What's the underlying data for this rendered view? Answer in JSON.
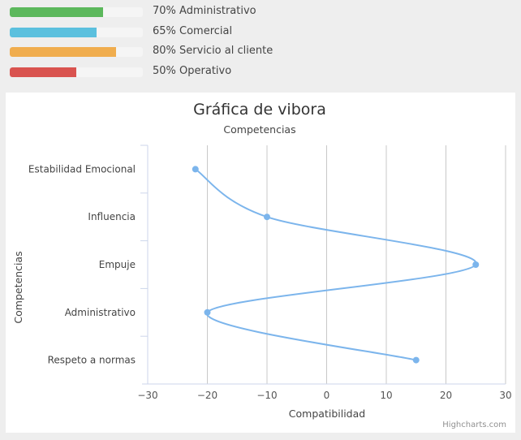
{
  "progress_bars": [
    {
      "label": "70% Administrativo",
      "value": 70,
      "color": "#5cb85c"
    },
    {
      "label": "65% Comercial",
      "value": 65,
      "color": "#5bc0de"
    },
    {
      "label": "80% Servicio al cliente",
      "value": 80,
      "color": "#f0ad4e"
    },
    {
      "label": "50% Operativo",
      "value": 50,
      "color": "#d9534f"
    }
  ],
  "chart_data": {
    "type": "line",
    "title": "Gráfica de vibora",
    "subtitle": "Competencias",
    "xlabel": "Compatibilidad",
    "ylabel": "Competencias",
    "categories": [
      "Estabilidad Emocional",
      "Influencia",
      "Empuje",
      "Administrativo",
      "Respeto a normas"
    ],
    "series": [
      {
        "values": [
          -22,
          -10,
          25,
          -20,
          15
        ],
        "color": "#7cb5ec"
      }
    ],
    "xlim": [
      -30,
      30
    ],
    "xticks": [
      -30,
      -20,
      -10,
      0,
      10,
      20,
      30
    ],
    "xtick_labels": [
      "−30",
      "−20",
      "−10",
      "0",
      "10",
      "20",
      "30"
    ],
    "inverted": true,
    "grid": true,
    "credits": "Highcharts.com"
  }
}
